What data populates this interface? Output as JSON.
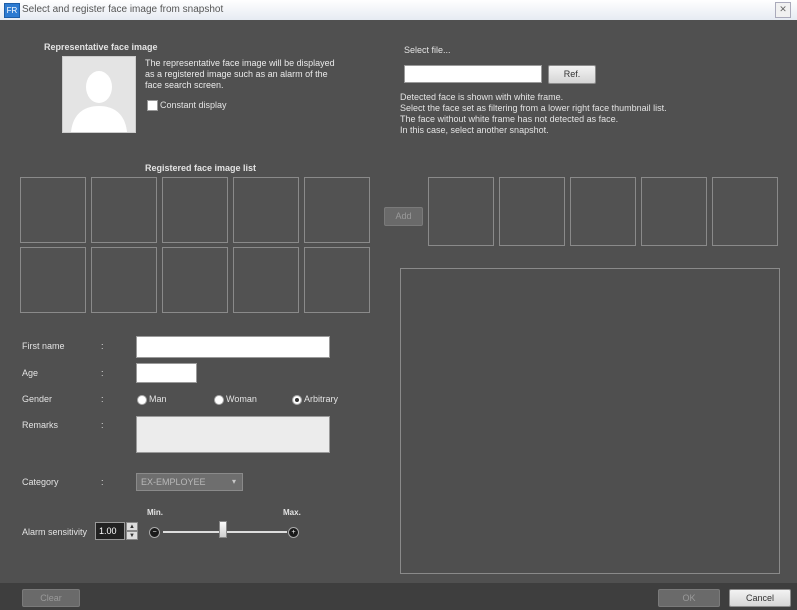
{
  "window": {
    "title": "Select and register face image from snapshot",
    "close_glyph": "✕",
    "app_icon": "FR"
  },
  "representative": {
    "heading": "Representative face image",
    "description": "The representative face image will be displayed as a registered image such as an alarm of the face search screen.",
    "constant_display_label": "Constant display"
  },
  "registered_list": {
    "heading": "Registered face image list",
    "row1": [
      "",
      "",
      "",
      "",
      ""
    ],
    "row2": [
      "",
      "",
      "",
      "",
      ""
    ]
  },
  "select_file": {
    "heading": "Select file...",
    "path_value": "",
    "ref_label": "Ref.",
    "info_lines": [
      "Detected face is shown with white frame.",
      "Select the face set as filtering from a lower right face thumbnail list.",
      "The face without white frame has not detected as face.",
      "In this case, select another snapshot."
    ]
  },
  "add_button_label": "Add",
  "detected_thumbs": [
    "",
    "",
    "",
    "",
    ""
  ],
  "form": {
    "first_name_label": "First name",
    "first_name_value": "",
    "age_label": "Age",
    "age_value": "",
    "gender_label": "Gender",
    "gender_options": [
      "Man",
      "Woman",
      "Arbitrary"
    ],
    "gender_selected": "Arbitrary",
    "remarks_label": "Remarks",
    "remarks_value": "",
    "category_label": "Category",
    "category_value": "EX-EMPLOYEE",
    "colon": ":",
    "alarm_label": "Alarm sensitivity",
    "alarm_value": "1.00",
    "min_label": "Min.",
    "max_label": "Max.",
    "minus_glyph": "−",
    "plus_glyph": "+",
    "spin_up_glyph": "▲",
    "spin_down_glyph": "▼",
    "dropdown_glyph": "▾",
    "slider_value_fraction": 0.48
  },
  "footer": {
    "clear_label": "Clear",
    "ok_label": "OK",
    "cancel_label": "Cancel"
  },
  "colors": {
    "panel": "#505050",
    "frame_border": "#8a8a8a",
    "title_bar": "#e6ebf2"
  }
}
